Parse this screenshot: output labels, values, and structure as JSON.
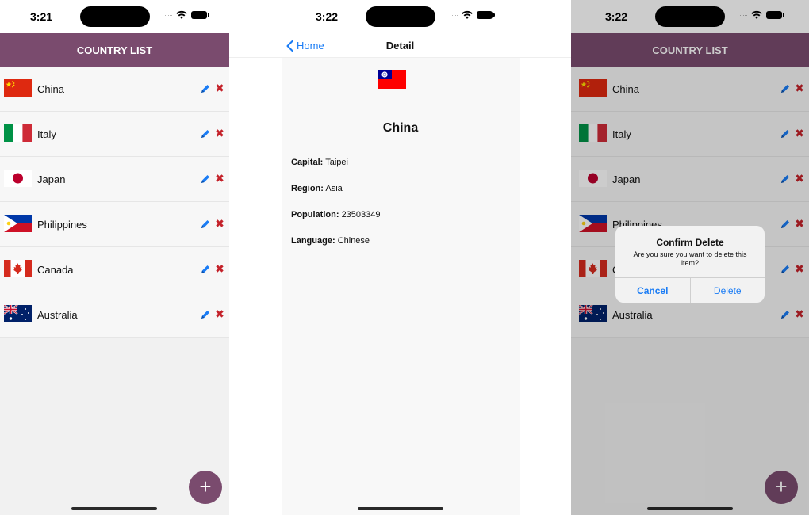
{
  "screens": {
    "list": {
      "time": "3:21",
      "header_title": "COUNTRY LIST",
      "countries": [
        {
          "name": "China",
          "flag": "china-flag-icon"
        },
        {
          "name": "Italy",
          "flag": "italy-flag-icon"
        },
        {
          "name": "Japan",
          "flag": "japan-flag-icon"
        },
        {
          "name": "Philippines",
          "flag": "philippines-flag-icon"
        },
        {
          "name": "Canada",
          "flag": "canada-flag-icon"
        },
        {
          "name": "Australia",
          "flag": "australia-flag-icon"
        }
      ],
      "fab_label": "+"
    },
    "detail": {
      "time": "3:22",
      "back_label": "Home",
      "nav_title": "Detail",
      "country_name": "China",
      "capital_label": "Capital:",
      "capital_value": "Taipei",
      "region_label": "Region:",
      "region_value": "Asia",
      "population_label": "Population:",
      "population_value": "23503349",
      "language_label": "Language:",
      "language_value": "Chinese"
    },
    "confirm": {
      "time": "3:22",
      "header_title": "COUNTRY LIST",
      "countries": [
        {
          "name": "China"
        },
        {
          "name": "Italy"
        },
        {
          "name": "Japan"
        },
        {
          "name": "Philippines"
        },
        {
          "name": "C"
        },
        {
          "name": "Australia"
        }
      ],
      "alert_title": "Confirm Delete",
      "alert_message": "Are you sure you want to delete this item?",
      "cancel_label": "Cancel",
      "delete_label": "Delete",
      "fab_label": "+"
    }
  },
  "colors": {
    "header": "#7a4b6e",
    "accent": "#1a7cf5",
    "delete": "#c4222a"
  }
}
